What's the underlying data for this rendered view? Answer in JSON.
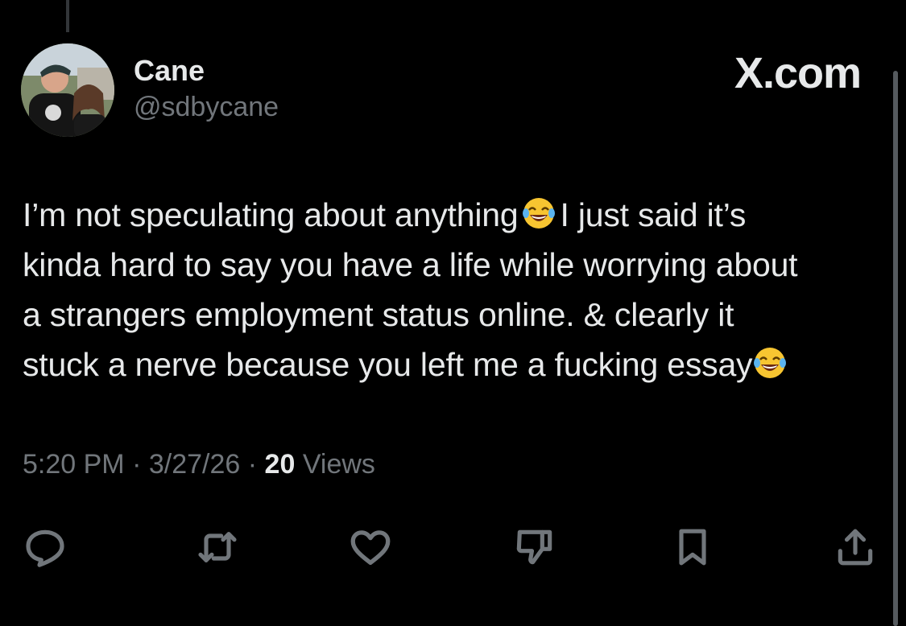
{
  "author": {
    "display_name": "Cane",
    "handle": "@sdbycane"
  },
  "brand": {
    "site_label": "X.com"
  },
  "tweet": {
    "lines": [
      "I’m not speculating about anything",
      "I just said it’s",
      "kinda hard to say you have a life while worrying about",
      "a strangers employment status online. & clearly it",
      "stuck a nerve because you left me a fucking essay"
    ],
    "emoji": "face-with-tears-of-joy"
  },
  "meta": {
    "time": "5:20 PM",
    "date": "3/27/26",
    "separator": "·",
    "views_count": "20",
    "views_label": "Views"
  },
  "actions": [
    {
      "name": "reply",
      "icon": "reply-icon"
    },
    {
      "name": "retweet",
      "icon": "retweet-icon"
    },
    {
      "name": "like",
      "icon": "heart-icon"
    },
    {
      "name": "dislike",
      "icon": "thumbs-down-icon"
    },
    {
      "name": "bookmark",
      "icon": "bookmark-icon"
    },
    {
      "name": "share",
      "icon": "share-icon"
    }
  ],
  "colors": {
    "background": "#000000",
    "text_primary": "#e7e9ea",
    "text_secondary": "#71767b"
  }
}
